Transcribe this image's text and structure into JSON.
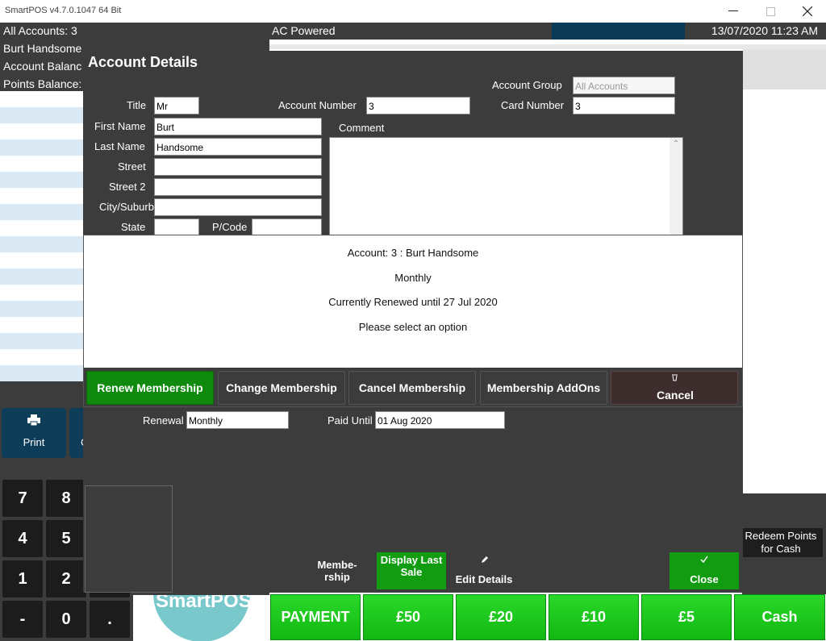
{
  "window": {
    "title": "SmartPOS v4.7.0.1047 64 Bit"
  },
  "status": {
    "accounts": "All Accounts: 3",
    "power": "AC Powered",
    "datetime": "13/07/2020 11:23 AM"
  },
  "left_list": {
    "name": "Burt Handsome",
    "balance_label": "Account Balanc",
    "points_label": "Points Balance:"
  },
  "print_label": "Print",
  "second_btn_label": "C",
  "numpad": [
    "7",
    "8",
    "4",
    "5",
    "1",
    "2",
    "-",
    "0",
    "."
  ],
  "logo_text": "SmartPOS",
  "redeem_label": "Redeem Points for Cash",
  "payment_row": [
    "PAYMENT",
    "£50",
    "£20",
    "£10",
    "£5",
    "Cash"
  ],
  "details": {
    "header": "Account Details",
    "account_group_label": "Account Group",
    "account_group": "All Accounts",
    "title_label": "Title",
    "title": "Mr",
    "account_number_label": "Account Number",
    "account_number": "3",
    "card_number_label": "Card Number",
    "card_number": "3",
    "first_name_label": "First Name",
    "first_name": "Burt",
    "last_name_label": "Last Name",
    "last_name": "Handsome",
    "comment_label": "Comment",
    "street_label": "Street",
    "street": "",
    "street2_label": "Street 2",
    "street2": "",
    "city_label": "City/Suburb",
    "city": "",
    "state_label": "State",
    "state": "",
    "pcode_label": "P/Code",
    "pcode": "",
    "renewal_label": "Renewal",
    "renewal": "Monthly",
    "paid_until_label": "Paid Until",
    "paid_until": "01 Aug 2020",
    "membership_label": "Membe-rship",
    "display_last_sale_label": "Display Last Sale",
    "edit_details_label": "Edit Details",
    "close_label": "Close"
  },
  "modal": {
    "account_line": "Account: 3 : Burt  Handsome",
    "plan": "Monthly",
    "renewed_line": "Currently Renewed until 27 Jul 2020",
    "prompt": "Please select an option",
    "buttons": {
      "renew": "Renew Membership",
      "change": "Change Membership",
      "cancel_membership": "Cancel Membership",
      "addons": "Membership AddOns",
      "cancel": "Cancel"
    }
  },
  "colors": {
    "dark_bg": "#3c3c3c",
    "green": "#119c11",
    "bright_green": "#22cc22",
    "navy": "#0e3d5a",
    "cancel_brown": "#3e2d2d"
  }
}
